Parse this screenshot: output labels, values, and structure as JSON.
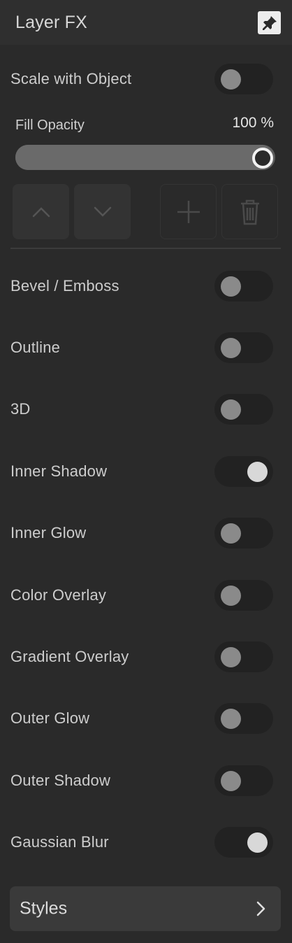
{
  "header": {
    "title": "Layer FX",
    "pin_icon": "pin-icon"
  },
  "scale_with_object": {
    "label": "Scale with Object",
    "on": false
  },
  "fill_opacity": {
    "label": "Fill Opacity",
    "value_text": "100 %",
    "value": 1.0
  },
  "toolbar": {
    "move_up_icon": "chevron-up-icon",
    "move_down_icon": "chevron-down-icon",
    "add_icon": "plus-icon",
    "delete_icon": "trash-icon"
  },
  "effects": [
    {
      "label": "Bevel / Emboss",
      "on": false
    },
    {
      "label": "Outline",
      "on": false
    },
    {
      "label": "3D",
      "on": false
    },
    {
      "label": "Inner Shadow",
      "on": true
    },
    {
      "label": "Inner Glow",
      "on": false
    },
    {
      "label": "Color Overlay",
      "on": false
    },
    {
      "label": "Gradient Overlay",
      "on": false
    },
    {
      "label": "Outer Glow",
      "on": false
    },
    {
      "label": "Outer Shadow",
      "on": false
    },
    {
      "label": "Gaussian Blur",
      "on": true
    }
  ],
  "styles": {
    "label": "Styles",
    "chevron_icon": "chevron-right-icon"
  },
  "colors": {
    "panel_bg": "#2a2a2a",
    "header_bg": "#2f2f2f",
    "toggle_track": "#222222",
    "knob_off": "#8a8a8a",
    "knob_on": "#d8d8d8"
  }
}
